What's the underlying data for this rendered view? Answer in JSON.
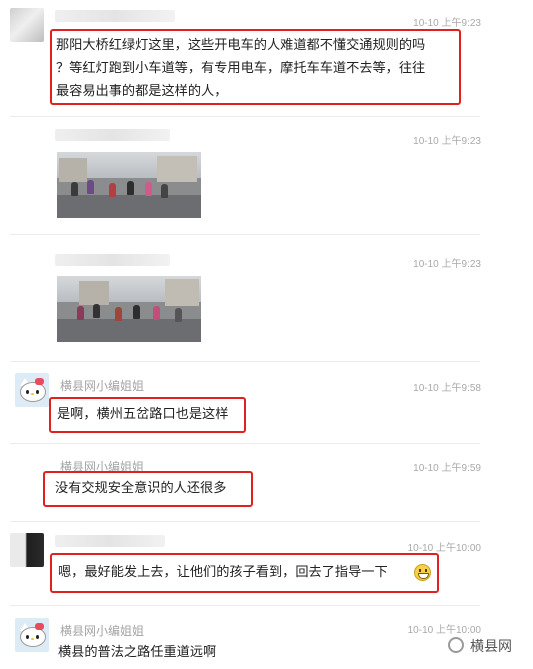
{
  "messages": [
    {
      "id": "m1",
      "sender": "",
      "time": "10-10 上午9:23",
      "text_lines": [
        "那阳大桥红绿灯这里，这些开电车的人难道都不懂交通规则的吗",
        "？等红灯跑到小车道等，有专用电车，摩托车车道不去等，往往",
        "最容易出事的都是这样的人，"
      ]
    },
    {
      "id": "m2",
      "sender": "",
      "time": "10-10 上午9:23",
      "image": "traffic-photo"
    },
    {
      "id": "m3",
      "sender": "",
      "time": "10-10 上午9:23",
      "image": "traffic-photo"
    },
    {
      "id": "m4",
      "sender": "横县网小编姐姐",
      "time": "10-10 上午9:58",
      "text": "是啊，横州五岔路口也是这样"
    },
    {
      "id": "m5",
      "sender": "横县网小编姐姐",
      "time": "10-10 上午9:59",
      "text": "没有交规安全意识的人还很多"
    },
    {
      "id": "m6",
      "sender": "",
      "time": "10-10 上午10:00",
      "text": "嗯，最好能发上去，让他们的孩子看到，回去了指导一下",
      "emoji": "grinning-face"
    },
    {
      "id": "m7",
      "sender": "横县网小编姐姐",
      "time": "10-10 上午10:00",
      "text": "横县的普法之路任重道远啊"
    }
  ],
  "watermark": "横县网",
  "colors": {
    "highlight": "#e0211f",
    "time": "#a9a9a9",
    "name": "#a4a4a4"
  }
}
